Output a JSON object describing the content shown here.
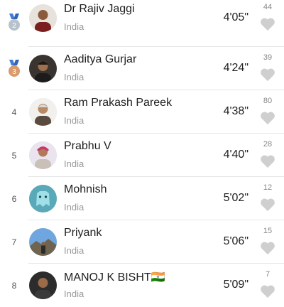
{
  "leaderboard": {
    "entries": [
      {
        "rank": "2",
        "medal": "silver",
        "name": "Dr Rajiv Jaggi",
        "country": "India",
        "time": "4'05\"",
        "likes": "44",
        "avatar": "person-avatar"
      },
      {
        "rank": "3",
        "medal": "bronze",
        "name": "Aaditya Gurjar",
        "country": "India",
        "time": "4'24\"",
        "likes": "39",
        "avatar": "person-avatar"
      },
      {
        "rank": "4",
        "medal": "",
        "name": "Ram Prakash Pareek",
        "country": "India",
        "time": "4'38\"",
        "likes": "80",
        "avatar": "person-avatar"
      },
      {
        "rank": "5",
        "medal": "",
        "name": "Prabhu V",
        "country": "India",
        "time": "4'40\"",
        "likes": "28",
        "avatar": "person-avatar"
      },
      {
        "rank": "6",
        "medal": "",
        "name": "Mohnish",
        "country": "India",
        "time": "5'02\"",
        "likes": "12",
        "avatar": "robot-avatar"
      },
      {
        "rank": "7",
        "medal": "",
        "name": "Priyank",
        "country": "India",
        "time": "5'06\"",
        "likes": "15",
        "avatar": "landscape-avatar"
      },
      {
        "rank": "8",
        "medal": "",
        "name": "MANOJ K BISHT🇮🇳",
        "country": "India",
        "time": "5'09\"",
        "likes": "7",
        "avatar": "person-avatar"
      }
    ]
  },
  "colors": {
    "silver_medal": "#b8c2cc",
    "bronze_medal": "#d99a6c",
    "ribbon": "#3f7fd6",
    "heart": "#cfcfcf"
  }
}
